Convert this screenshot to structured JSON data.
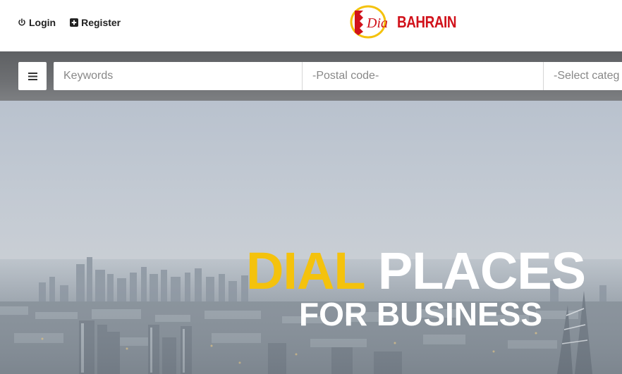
{
  "header": {
    "login_label": "Login",
    "register_label": "Register",
    "logo": {
      "badge_text": "Dial",
      "name": "BAHRAIN",
      "brand_color": "#d1121b",
      "accent_color": "#f4c20d"
    }
  },
  "search": {
    "menu_icon": "hamburger-icon",
    "keywords_placeholder": "Keywords",
    "postal_placeholder": "-Postal code-",
    "category_selected": "-Select categ"
  },
  "hero": {
    "word_dial": "DIAL",
    "word_places": "PLACES",
    "line2": "FOR BUSINESS",
    "dial_color": "#f4c20d"
  }
}
